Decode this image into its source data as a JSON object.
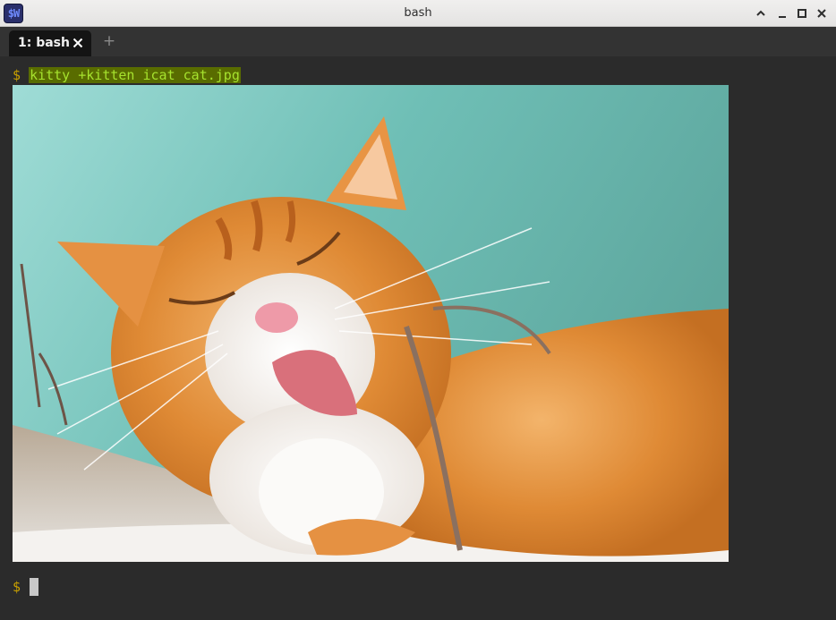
{
  "window": {
    "title": "bash",
    "icon_text": "$W",
    "controls": [
      "chevron-up-icon",
      "minimize-icon",
      "maximize-icon",
      "close-icon"
    ]
  },
  "tabs": {
    "items": [
      {
        "label": "1: bash",
        "active": true
      }
    ],
    "new_tab_label": "+"
  },
  "terminal": {
    "prompt": "$",
    "command": "kitty +kitten icat cat.jpg",
    "image_alt": "cat.jpg",
    "colors": {
      "background": "#2b2b2b",
      "prompt": "#c8a000",
      "command_fg": "#a6e22e",
      "command_bg": "#596c00"
    }
  }
}
